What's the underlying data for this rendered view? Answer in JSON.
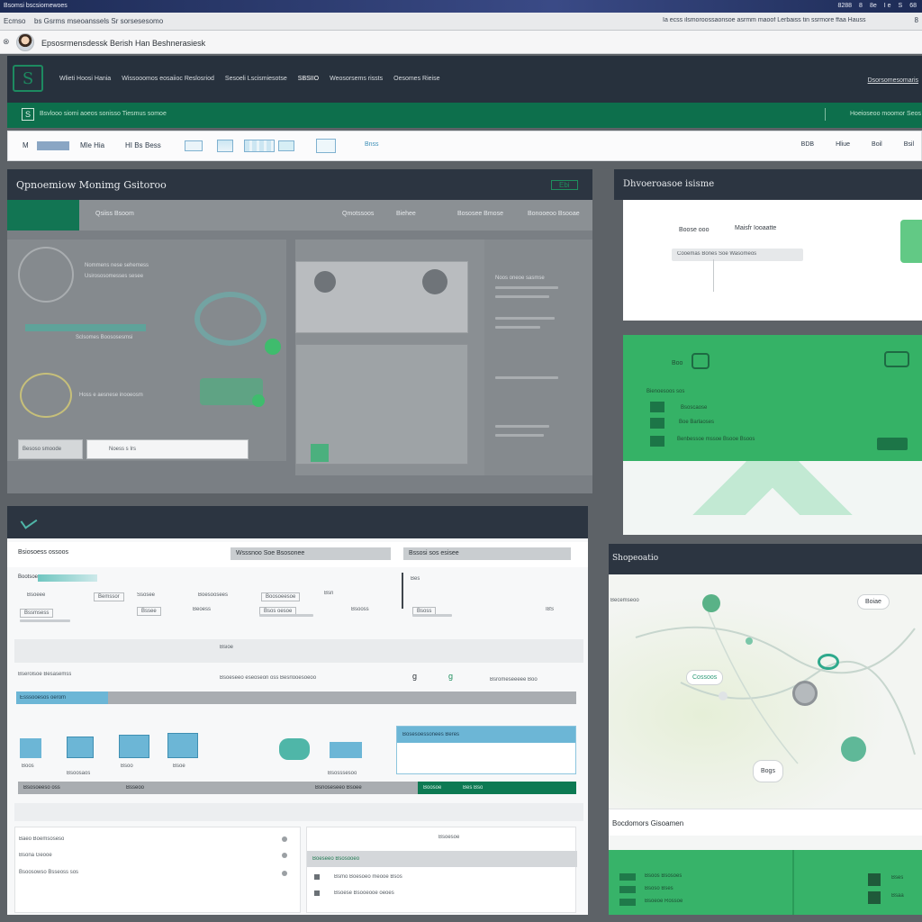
{
  "os_bar": {
    "title": "Bsomsi bscsiomewoes",
    "indicators": [
      "8288",
      "8",
      "8e",
      "I e",
      "S",
      "68"
    ]
  },
  "browser_tabs": {
    "label": "Ecmso",
    "url": "bs Gsrms mseoanssels Sr sorsesesomo",
    "right_text": "Ia ecss ilsmoroossaonsoe asrmm maoof Lerbaiss tin ssrmore ffaa Hauss",
    "right_icon": "8"
  },
  "address_bar": {
    "back": "⊗",
    "text": "Epsosrmensdessk Berish Han Beshnerasiesk"
  },
  "app_header": {
    "logo": "S",
    "nav": [
      "Wlieti Hoosi Hania",
      "Wissooomos eosaiioc Reslosriod",
      "Sesoeli Lscismiesotse",
      "SBSIIO",
      "Weosorsems rissts",
      "Oesomes Rieise"
    ],
    "action": "Dsorsomesomaris"
  },
  "green_bar": {
    "logo": "S",
    "text": "Bsvlooo siomi aoeos sonisso Tiesmus somoe",
    "right": "Hoeioseoo moomor Seos"
  },
  "toolbar": {
    "items": [
      "M",
      "Mle Hia",
      "HI Bs",
      "Bess",
      "Bnss"
    ],
    "right": [
      "BDB",
      "Hliue",
      "Boil",
      "Bsil"
    ]
  },
  "panel_monitor": {
    "title": "Qpnoemiow Monimg Gsitoroo",
    "right": "Ebi",
    "tab": "Qsiiss Bsoom",
    "tabs": [
      "Qmotssoos",
      "Biehee",
      "Bososee Bmose",
      "Bonooeoo Bsooae"
    ],
    "rows": [
      "Nommens nese sehemess",
      "Usirososomesses sesee",
      "Sclsomes Boososesmsi",
      "Hoss e aesnese inooeosm",
      "Noos oneoe sasmse"
    ],
    "input_left": "Besoso smoode",
    "input_right": "Noess s Irs"
  },
  "panel_right_top": {
    "title": "Dhvoeroasoe isisme",
    "labels": [
      "Boose ooo",
      "Maisfr Iooaatte",
      "Cooemas Bones Soe Wasomeos"
    ]
  },
  "panel_green": {
    "labels": [
      "Boo",
      "Bienoesoos sos",
      "Bsoscaose",
      "Boe Barlaoses",
      "Benbessoe mssoe Bsooe Bsoos"
    ]
  },
  "panel_table": {
    "headers": [
      "Bsiosoess ossoos",
      "Wsssnoo Soe Bsosonee",
      "Bssosi sos esisee"
    ],
    "rows": [
      [
        "Bootsoe",
        "Bsoeee",
        "Bemssor",
        "Ssosee",
        "Boesoosees",
        "Boosoeesoe",
        "Bsn",
        "Bes"
      ],
      [
        "Bssmsess",
        "Bssee",
        "Beoess",
        "Bsos oesoe",
        "Bsooss",
        "Bsoss",
        "I8S"
      ]
    ],
    "mid_text": [
      "Bsioe",
      "Bserolsoe Besasemss",
      "Bsoeseeo eseoseon oss Besrlooesoeoo",
      "Bsromeseeeee Boo"
    ],
    "blue_bar": "Esssooesos oerom",
    "cards": [
      "Boos",
      "Bsoosaos",
      "Bsoo",
      "Bsoe",
      "Bsosssesoo"
    ],
    "blue_card": "Bosesoessonees Beres",
    "tabs": [
      "Bsosoeeso oss",
      "Bsseoo",
      "Bsnoseseeo Bsoee",
      "Boosoe",
      "Bes Bso"
    ],
    "bottom_left": [
      "Baeo Boemsoseso",
      "Bsona Geooe",
      "Bsoosowso Bsseoss sos"
    ],
    "bottom_right": [
      "Bsoesoe",
      "Boeseeo Bsosooeo",
      "Bsmo Boesoeo meooe Bsos",
      "Bsoese Bsooeooe oeoes"
    ]
  },
  "panel_map": {
    "title": "Shopeoatio",
    "label": "Becemseoo",
    "pills": [
      "Boiae",
      "Cossoos",
      "Bogs"
    ],
    "footer": "Bocdomors Gisoamen",
    "green_rows": [
      "Bsoos Bsosoes",
      "Bsoso Bses",
      "Bsoeoe Rossoe"
    ],
    "green_right": [
      "Bses",
      "Bsaa"
    ]
  },
  "colors": {
    "navy": "#2c3846",
    "green": "#0d7a53",
    "bright_green": "#3cbd6d",
    "blue": "#6cb6d6"
  }
}
